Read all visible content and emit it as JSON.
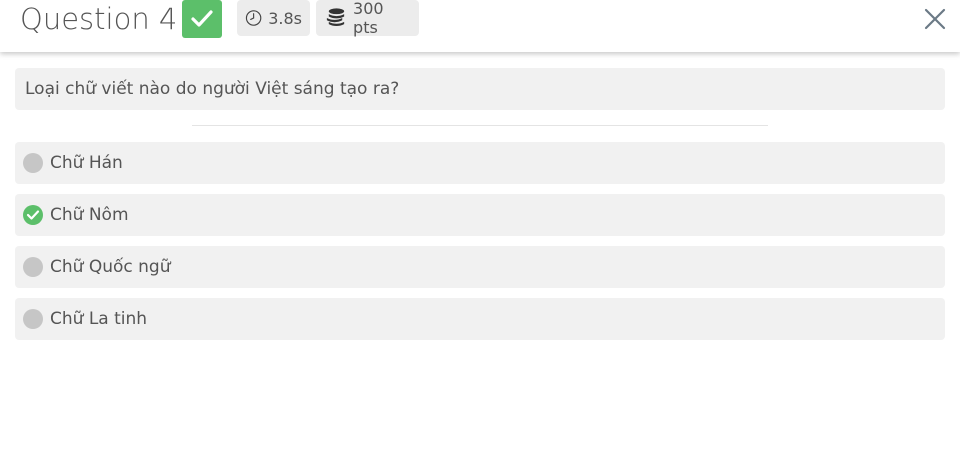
{
  "header": {
    "title": "Question 4",
    "status_icon": "check-icon",
    "time": "3.8s",
    "time_icon": "clock-icon",
    "points": "300 pts",
    "points_icon": "coins-icon",
    "close_icon": "close-icon"
  },
  "question": {
    "text": "Loại chữ viết nào do người Việt sáng tạo ra?"
  },
  "options": [
    {
      "label": "Chữ Hán",
      "selected": false
    },
    {
      "label": "Chữ Nôm",
      "selected": true
    },
    {
      "label": "Chữ Quốc ngữ",
      "selected": false
    },
    {
      "label": "Chữ La tinh",
      "selected": false
    }
  ],
  "colors": {
    "correct_green": "#5cbf6a",
    "option_bg": "#f1f1f1",
    "unselected_dot": "#c6c6c6"
  }
}
